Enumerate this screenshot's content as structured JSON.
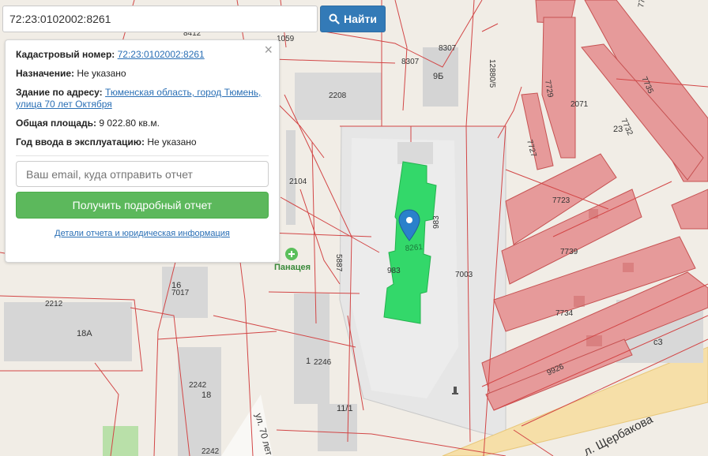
{
  "search": {
    "value": "72:23:0102002:8261",
    "button_label": "Найти"
  },
  "info_panel": {
    "close_symbol": "×",
    "cadastral_label": "Кадастровый номер:",
    "cadastral_value": "72:23:0102002:8261",
    "purpose_label": "Назначение:",
    "purpose_value": "Не указано",
    "address_label": "Здание по адресу:",
    "address_line1": "Тюменская область, город Тюмень,",
    "address_line2": "улица 70 лет Октября",
    "area_label": "Общая площадь:",
    "area_value": "9 022.80 кв.м.",
    "year_label": "Год ввода в эксплуатацию:",
    "year_value": "Не указано",
    "email_placeholder": "Ваш email, куда отправить отчет",
    "report_button": "Получить подробный отчет",
    "details_link": "Детали отчета и юридическая информация"
  },
  "map": {
    "labels": {
      "l8412": "8412",
      "l1059": "1059",
      "l8307": "8307",
      "l9b": "9Б",
      "l2208": "2208",
      "l12880": "12880/5",
      "l2104": "2104",
      "l8261": "8261",
      "l983a": "983",
      "l983b": "983",
      "l7003": "7003",
      "l5887": "5887",
      "l16": "16",
      "l7017": "7017",
      "l2212": "2212",
      "l18a": "18А",
      "l2242a": "2242",
      "l18": "18",
      "l2246": "2246",
      "l1": "1",
      "l11_1": "11/1",
      "l2242b": "2242",
      "l7736": "7736",
      "l7735": "7735",
      "l7729": "7729",
      "l2071": "2071",
      "l7732": "7732",
      "l23": "23",
      "l7727": "7727",
      "l7723": "7723",
      "l7739": "7739",
      "l7734": "7734",
      "l9926": "9926",
      "lc3": "с3",
      "street_70": "ул. 70 лет",
      "street_sherbakova": "л. Щербакова"
    },
    "poi": {
      "pharmacy": "Панацея"
    },
    "colors": {
      "parcel_red": "#e06a6a",
      "selected_green": "#2ecc60",
      "marker_blue": "#2a81cb",
      "pharmacy_green": "#5bbf5b"
    },
    "icons": {
      "marker": "map-pin-icon",
      "pharmacy": "plus-circle-icon"
    }
  }
}
